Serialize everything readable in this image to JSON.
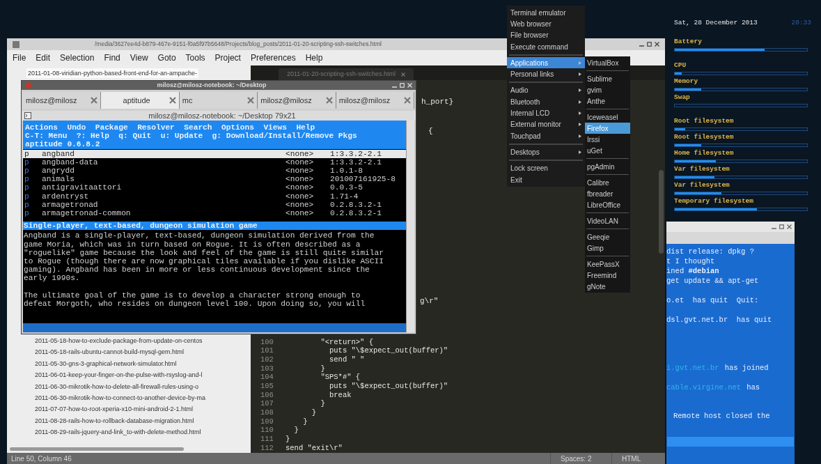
{
  "editor": {
    "title": "/media/3627ee4d-b879-467e-9151-f0a5f97b5648/Projects/blog_posts/2011-01-20-scripting-ssh-switches.html",
    "menu": [
      "File",
      "Edit",
      "Selection",
      "Find",
      "View",
      "Goto",
      "Tools",
      "Project",
      "Preferences",
      "Help"
    ],
    "tab": "2011-01-20-scripting-ssh-switches.html",
    "sidebar_top": "2011-01-08-viridian-python-based-front-end-for-an-ampache-",
    "sidebar_files": [
      "2011-05-18-how-to-exclude-package-from-update-on-centos",
      "2011-05-18-rails-ubuntu-cannot-build-mysql-gem.html",
      "2011-05-30-gns-3-graphical-network-simulator.html",
      "2011-06-01-keep-your-finger-on-the-pulse-with-rsyslog-and-l",
      "2011-06-30-mikrotik-how-to-delete-all-firewall-rules-using-o",
      "2011-06-30-mikrotik-how-to-connect-to-another-device-by-ma",
      "2011-07-07-how-to-root-xperia-x10-mini-android-2-1.html",
      "2011-08-28-rails-how-to-rollback-database-migration.html",
      "2011-08-29-rails-jquery-and-link_to-with-delete-method.html"
    ],
    "code_fragments": [
      "h_port}",
      "{",
      "g\\r\""
    ],
    "code_lines": [
      {
        "number": "100",
        "code": "        \"<return>\" {"
      },
      {
        "number": "101",
        "code": "          puts \"\\$expect_out(buffer)\""
      },
      {
        "number": "102",
        "code": "          send \" \""
      },
      {
        "number": "103",
        "code": "        }"
      },
      {
        "number": "104",
        "code": "        \"SPS*#\" {"
      },
      {
        "number": "105",
        "code": "          puts \"\\$expect_out(buffer)\""
      },
      {
        "number": "106",
        "code": "          break"
      },
      {
        "number": "107",
        "code": "        }"
      },
      {
        "number": "108",
        "code": "      }"
      },
      {
        "number": "109",
        "code": "    }"
      },
      {
        "number": "110",
        "code": "  }"
      },
      {
        "number": "111",
        "code": "}"
      },
      {
        "number": "112",
        "code": "send \"exit\\r\""
      }
    ],
    "status_bar": {
      "position": "Line 50, Column 46",
      "indentation": "Spaces: 2",
      "syntax": "HTML"
    }
  },
  "terminal": {
    "title": "milosz@milosz-notebook: ~/Desktop",
    "tabs": [
      {
        "label": "milosz@milosz",
        "selected": false
      },
      {
        "label": "aptitude",
        "selected": true
      },
      {
        "label": "mc",
        "selected": false
      },
      {
        "label": "milosz@milosz",
        "selected": false
      },
      {
        "label": "milosz@milosz",
        "selected": false
      }
    ],
    "subtitle": "milosz@milosz-notebook: ~/Desktop 79x21",
    "menu_line": "Actions  Undo  Package  Resolver  Search  Options  Views  Help",
    "help_line": "C-T: Menu  ?: Help  q: Quit  u: Update  g: Download/Install/Remove Pkgs",
    "version": "aptitude 0.6.8.2",
    "packages": [
      {
        "state": "p",
        "name": "angband",
        "installed": "<none>",
        "version": "1:3.3.2-2.1",
        "selected": true
      },
      {
        "state": "p",
        "name": "angband-data",
        "installed": "<none>",
        "version": "1:3.3.2-2.1",
        "selected": false
      },
      {
        "state": "p",
        "name": "angrydd",
        "installed": "<none>",
        "version": "1.0.1-8",
        "selected": false
      },
      {
        "state": "p",
        "name": "animals",
        "installed": "<none>",
        "version": "201007161925-8",
        "selected": false
      },
      {
        "state": "p",
        "name": "antigravitaattori",
        "installed": "<none>",
        "version": "0.0.3-5",
        "selected": false
      },
      {
        "state": "p",
        "name": "ardentryst",
        "installed": "<none>",
        "version": "1.71-4",
        "selected": false
      },
      {
        "state": "p",
        "name": "armagetronad",
        "installed": "<none>",
        "version": "0.2.8.3.2-1",
        "selected": false
      },
      {
        "state": "p",
        "name": "armagetronad-common",
        "installed": "<none>",
        "version": "0.2.8.3.2-1",
        "selected": false
      }
    ],
    "description_title": "Single-player, text-based, dungeon simulation game",
    "description": [
      "Angband is a single-player, text-based, dungeon simulation derived from the",
      "game Moria, which was in turn based on Rogue. It is often described as a",
      "\"roguelike\" game because the look and feel of the game is still quite similar",
      "to Rogue (though there are now graphical tiles available if you dislike ASCII",
      "gaming). Angband has been in more or less continuous development since the",
      "early 1990s.",
      "The ultimate goal of the game is to develop a character strong enough to",
      "defeat Morgoth, who resides on dungeon level 100. Upon doing so, you will"
    ]
  },
  "app_menu": {
    "items": [
      {
        "label": "Terminal emulator",
        "has_submenu": false,
        "selected": false,
        "separator_after": false
      },
      {
        "label": "Web browser",
        "has_submenu": false,
        "selected": false,
        "separator_after": false
      },
      {
        "label": "File browser",
        "has_submenu": false,
        "selected": false,
        "separator_after": false
      },
      {
        "label": "Execute command",
        "has_submenu": false,
        "selected": false,
        "separator_after": true
      },
      {
        "label": "Applications",
        "has_submenu": true,
        "selected": true,
        "separator_after": false
      },
      {
        "label": "Personal links",
        "has_submenu": true,
        "selected": false,
        "separator_after": true
      },
      {
        "label": "Audio",
        "has_submenu": true,
        "selected": false,
        "separator_after": false
      },
      {
        "label": "Bluetooth",
        "has_submenu": true,
        "selected": false,
        "separator_after": false
      },
      {
        "label": "Internal LCD",
        "has_submenu": true,
        "selected": false,
        "separator_after": false
      },
      {
        "label": "External monitor",
        "has_submenu": true,
        "selected": false,
        "separator_after": false
      },
      {
        "label": "Touchpad",
        "has_submenu": true,
        "selected": false,
        "separator_after": true
      },
      {
        "label": "Desktops",
        "has_submenu": true,
        "selected": false,
        "separator_after": true
      },
      {
        "label": "Lock screen",
        "has_submenu": false,
        "selected": false,
        "separator_after": false
      },
      {
        "label": "Exit",
        "has_submenu": false,
        "selected": false,
        "separator_after": false
      }
    ]
  },
  "submenu": {
    "items": [
      {
        "label": "VirtualBox",
        "selected": false,
        "separator_after": true
      },
      {
        "label": "Sublime",
        "selected": false,
        "separator_after": false
      },
      {
        "label": "gvim",
        "selected": false,
        "separator_after": false
      },
      {
        "label": "Anthe",
        "selected": false,
        "separator_after": true
      },
      {
        "label": "Iceweasel",
        "selected": false,
        "separator_after": false
      },
      {
        "label": "Firefox",
        "selected": true,
        "separator_after": false
      },
      {
        "label": "Irssi",
        "selected": false,
        "separator_after": false
      },
      {
        "label": "uGet",
        "selected": false,
        "separator_after": true
      },
      {
        "label": "pgAdmin",
        "selected": false,
        "separator_after": true
      },
      {
        "label": "Calibre",
        "selected": false,
        "separator_after": false
      },
      {
        "label": "fbreader",
        "selected": false,
        "separator_after": false
      },
      {
        "label": "LibreOffice",
        "selected": false,
        "separator_after": true
      },
      {
        "label": "VideoLAN",
        "selected": false,
        "separator_after": true
      },
      {
        "label": "Geeqie",
        "selected": false,
        "separator_after": false
      },
      {
        "label": "Gimp",
        "selected": false,
        "separator_after": true
      },
      {
        "label": "KeePassX",
        "selected": false,
        "separator_after": false
      },
      {
        "label": "Freemind",
        "selected": false,
        "separator_after": false
      },
      {
        "label": "gNote",
        "selected": false,
        "separator_after": false
      }
    ]
  },
  "conky": {
    "date": "Sat, 28 December 2013",
    "time": "20:33",
    "meters": [
      {
        "label": "Battery",
        "level": 0.68
      },
      {
        "label": "CPU",
        "level": 0.05
      },
      {
        "label": "Memory",
        "level": 0.2
      },
      {
        "label": "Swap",
        "level": 0
      },
      {
        "label": "Root filesystem",
        "level": 0.08
      },
      {
        "label": "Root filesystem",
        "level": 0.2
      },
      {
        "label": "Home filesystem",
        "level": 0.31
      },
      {
        "label": "Var filesystem",
        "level": 0.3
      },
      {
        "label": "Var filesystem",
        "level": 0.35
      },
      {
        "label": "Temporary filesystem",
        "level": 0.62
      }
    ]
  },
  "irc": {
    "lines": [
      {
        "text": "dist release: dpkg ?"
      },
      {
        "text": "t I thought"
      },
      {
        "text": "ined **#debian**"
      },
      {
        "text": "get update && apt-get"
      },
      {
        "text": "o.et  has quit  Quit:"
      },
      {
        "text": "dsl.gvt.net.br  has quit"
      },
      {
        "host": "i.gvt.net.br",
        "text": "has joined"
      },
      {
        "host": "cable.virgine.net",
        "text": "has"
      },
      {
        "text": "Remote host closed the"
      }
    ]
  }
}
